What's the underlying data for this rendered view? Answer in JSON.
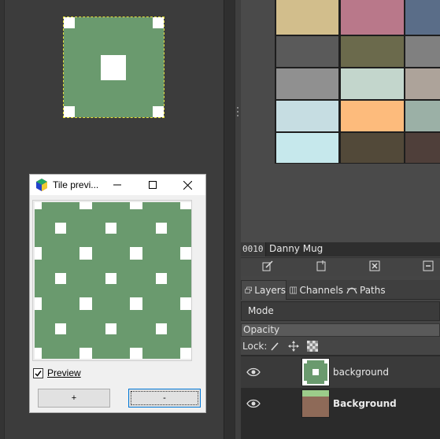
{
  "dialog": {
    "title": "Tile previ...",
    "preview_label": "Preview",
    "preview_checked": true,
    "btn_plus": "+",
    "btn_minus": "-"
  },
  "palette": {
    "index": "0010",
    "name": "Danny Mug",
    "colors": [
      [
        "#d2be8c",
        "#b9788a",
        "#5a6d88"
      ],
      [
        "#5a5a5a",
        "#6b6a4c",
        "#808080"
      ],
      [
        "#909090",
        "#c3d6cc",
        "#ada39a"
      ],
      [
        "#c6dde2",
        "#fdbb7c",
        "#9bb0a6"
      ],
      [
        "#c6e8ec",
        "#524939",
        "#4f3f3a"
      ]
    ]
  },
  "tabs": {
    "layers": "Layers",
    "channels": "Channels",
    "paths": "Paths"
  },
  "layers_panel": {
    "mode_label": "Mode",
    "opacity_label": "Opacity",
    "lock_label": "Lock:",
    "layers": [
      {
        "name": "background",
        "bold": false
      },
      {
        "name": "Background",
        "bold": true
      }
    ]
  },
  "colors": {
    "tile_green": "#6a9a6e",
    "selection_yellow": "#e7e23a"
  }
}
